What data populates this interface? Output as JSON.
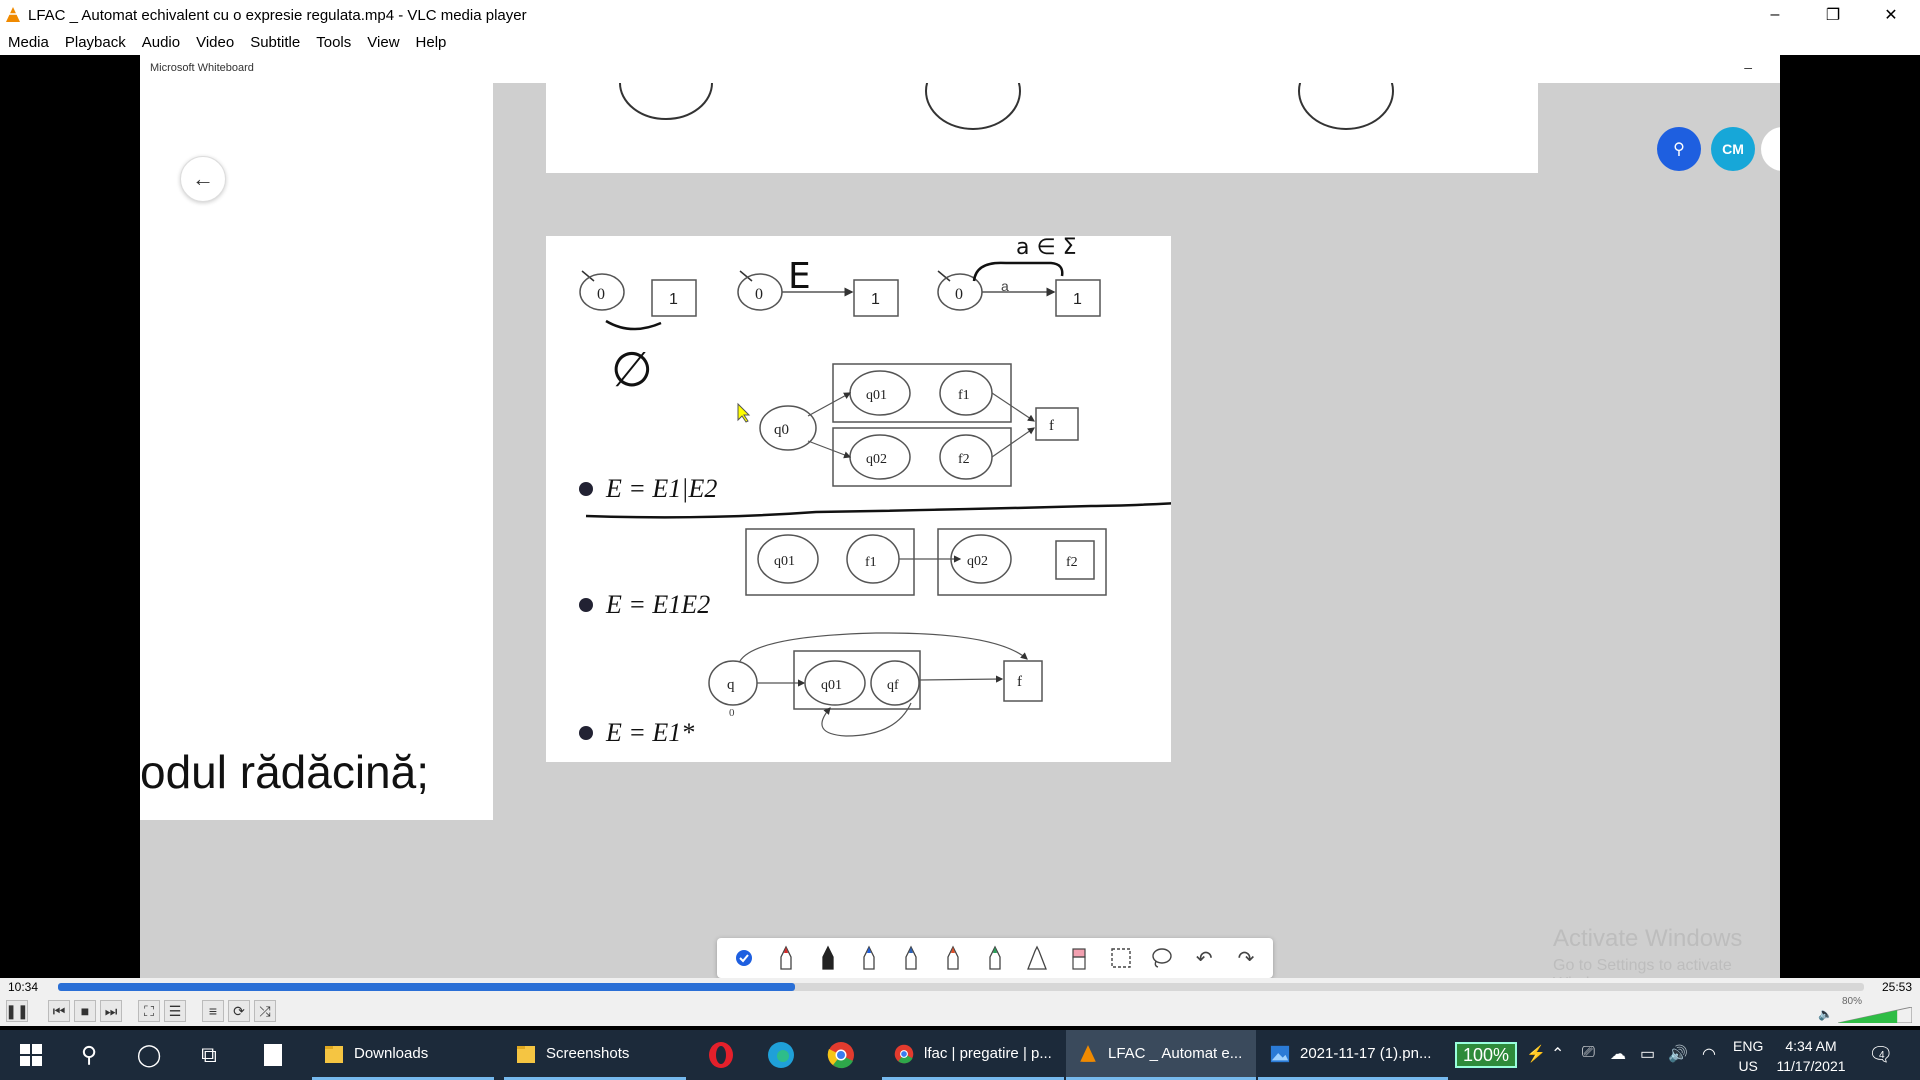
{
  "window": {
    "title": "LFAC _ Automat echivalent cu o expresie regulata.mp4 - VLC media player",
    "minimize": "–",
    "maximize": "❐",
    "close": "✕"
  },
  "menu": [
    "Media",
    "Playback",
    "Audio",
    "Video",
    "Subtitle",
    "Tools",
    "View",
    "Help"
  ],
  "whiteboard": {
    "header": "Microsoft Whiteboard",
    "minimize": "–",
    "back_icon": "arrow-left-icon",
    "root_text": "odul rădăcină;",
    "avatar_cm": "CM",
    "diagram": {
      "handwritten_sigma": "a ∈ Σ",
      "handwritten_epsilon": "E",
      "handwritten_empty": "∅",
      "eq1": "E = E1|E2",
      "eq2": "E = E1E2",
      "eq3": "E = E1*",
      "states": {
        "s0": "0",
        "s1": "1",
        "a": "a",
        "q0": "q0",
        "q01": "q01",
        "q02": "q02",
        "f1": "f1",
        "f2": "f2",
        "f": "f",
        "q": "q",
        "qf": "qf"
      }
    },
    "toolbar_icons": [
      "check-icon",
      "red-pen-icon",
      "black-pen-icon",
      "blue-pen-icon",
      "blue-pen-2-icon",
      "red-pen-2-icon",
      "green-pen-icon",
      "ruler-pen-icon",
      "eraser-icon",
      "select-icon",
      "lasso-icon",
      "undo-icon",
      "redo-icon"
    ],
    "activate_title": "Activate Windows",
    "activate_sub": "Go to Settings to activate Windows."
  },
  "player": {
    "time_current": "10:34",
    "time_total": "25:53",
    "progress": 0.408,
    "volume_label": "80%",
    "volume": 0.8
  },
  "taskbar": {
    "apps": [
      {
        "label": "Downloads",
        "icon": "folder-icon"
      },
      {
        "label": "Screenshots",
        "icon": "folder-icon"
      },
      {
        "label": "lfac | pregatire | p...",
        "icon": "chrome-icon"
      },
      {
        "label": "LFAC _ Automat e...",
        "icon": "vlc-icon"
      },
      {
        "label": "2021-11-17 (1).pn...",
        "icon": "photos-icon"
      }
    ],
    "battery": "100%",
    "lang_top": "ENG",
    "lang_bottom": "US",
    "time": "4:34 AM",
    "date": "11/17/2021",
    "notifications": "4"
  }
}
